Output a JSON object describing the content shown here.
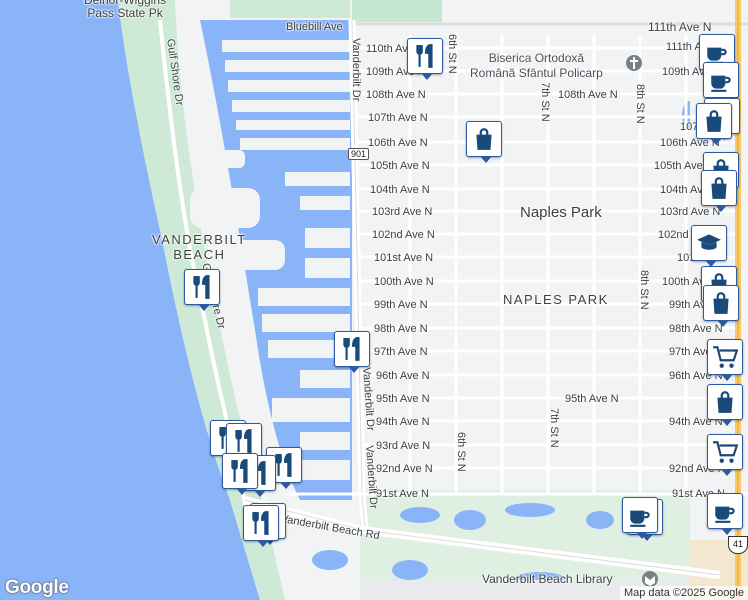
{
  "map": {
    "colors": {
      "water": "#8ab4f8",
      "land": "#f1f3f4",
      "park": "#c7e8d0",
      "beach": "#ceead6",
      "road": "#ffffff",
      "road_border": "#d0d4d9",
      "highway": "#f8c967",
      "marker_border": "#2c5aa0",
      "marker_icon": "#1a4a7a"
    },
    "labels": {
      "park_top": "Delnor-Wiggins\nPass State Pk",
      "bluebill": "Bluebill Ave",
      "ave111": "111th Ave N",
      "ave110": "110th Ave N",
      "ave109": "109th Ave N",
      "ave108": "108th Ave N",
      "ave107": "107th Ave N",
      "ave106": "106th Ave N",
      "ave105": "105th Ave N",
      "ave104": "104th Ave N",
      "ave103": "103rd Ave N",
      "ave102": "102nd Ave N",
      "ave101": "101st Ave N",
      "ave100": "100th Ave N",
      "ave99": "99th Ave N",
      "ave98": "98th Ave N",
      "ave97": "97th Ave N",
      "ave96": "96th Ave N",
      "ave95": "95th Ave N",
      "ave94": "94th Ave N",
      "ave93": "93rd Ave N",
      "ave92": "92nd Ave N",
      "ave91": "91st Ave N",
      "r111": "111th Ave N",
      "r109": "109th Ave N",
      "r107": "107th Ave N",
      "r106": "106th Ave N",
      "r105": "105th Ave N",
      "r104": "104th Ave N",
      "r103": "103rd Ave N",
      "r102": "102nd Ave",
      "r101": "101st Ave",
      "r100": "100th Ave",
      "r99": "99th Ave",
      "r98": "98th Ave N",
      "r97": "97th Ave N",
      "r96": "96th Ave N",
      "r94": "94th Ave N",
      "r92": "92nd Ave N",
      "r91": "91st Ave N",
      "mid108": "108th Ave N",
      "mid95": "95th Ave N",
      "church": "Biserica Ortodoxă\nRomână Sfântul Policarp",
      "naples_park": "Naples Park",
      "naples_park_caps": "NAPLES PARK",
      "vanderbilt_beach": "VANDERBILT\nBEACH",
      "gulf_shore": "Gulf Shore Dr",
      "gulf_shore2": "Gulf Shore Dr",
      "vanderbilt_dr1": "Vanderbilt Dr",
      "vanderbilt_dr2": "Vanderbilt Dr",
      "vanderbilt_dr3": "Vanderbilt Dr",
      "vb_rd": "Vanderbilt Beach Rd",
      "library": "Vanderbilt Beach Library",
      "st6a": "6th St N",
      "st6b": "6th St N",
      "st7a": "7th St N",
      "st7b": "7th St N",
      "st8a": "8th St N",
      "st8b": "8th St N",
      "shield901": "901",
      "shield41": "41"
    },
    "attribution": "Map data ©2025 Google",
    "logo": "Google"
  }
}
